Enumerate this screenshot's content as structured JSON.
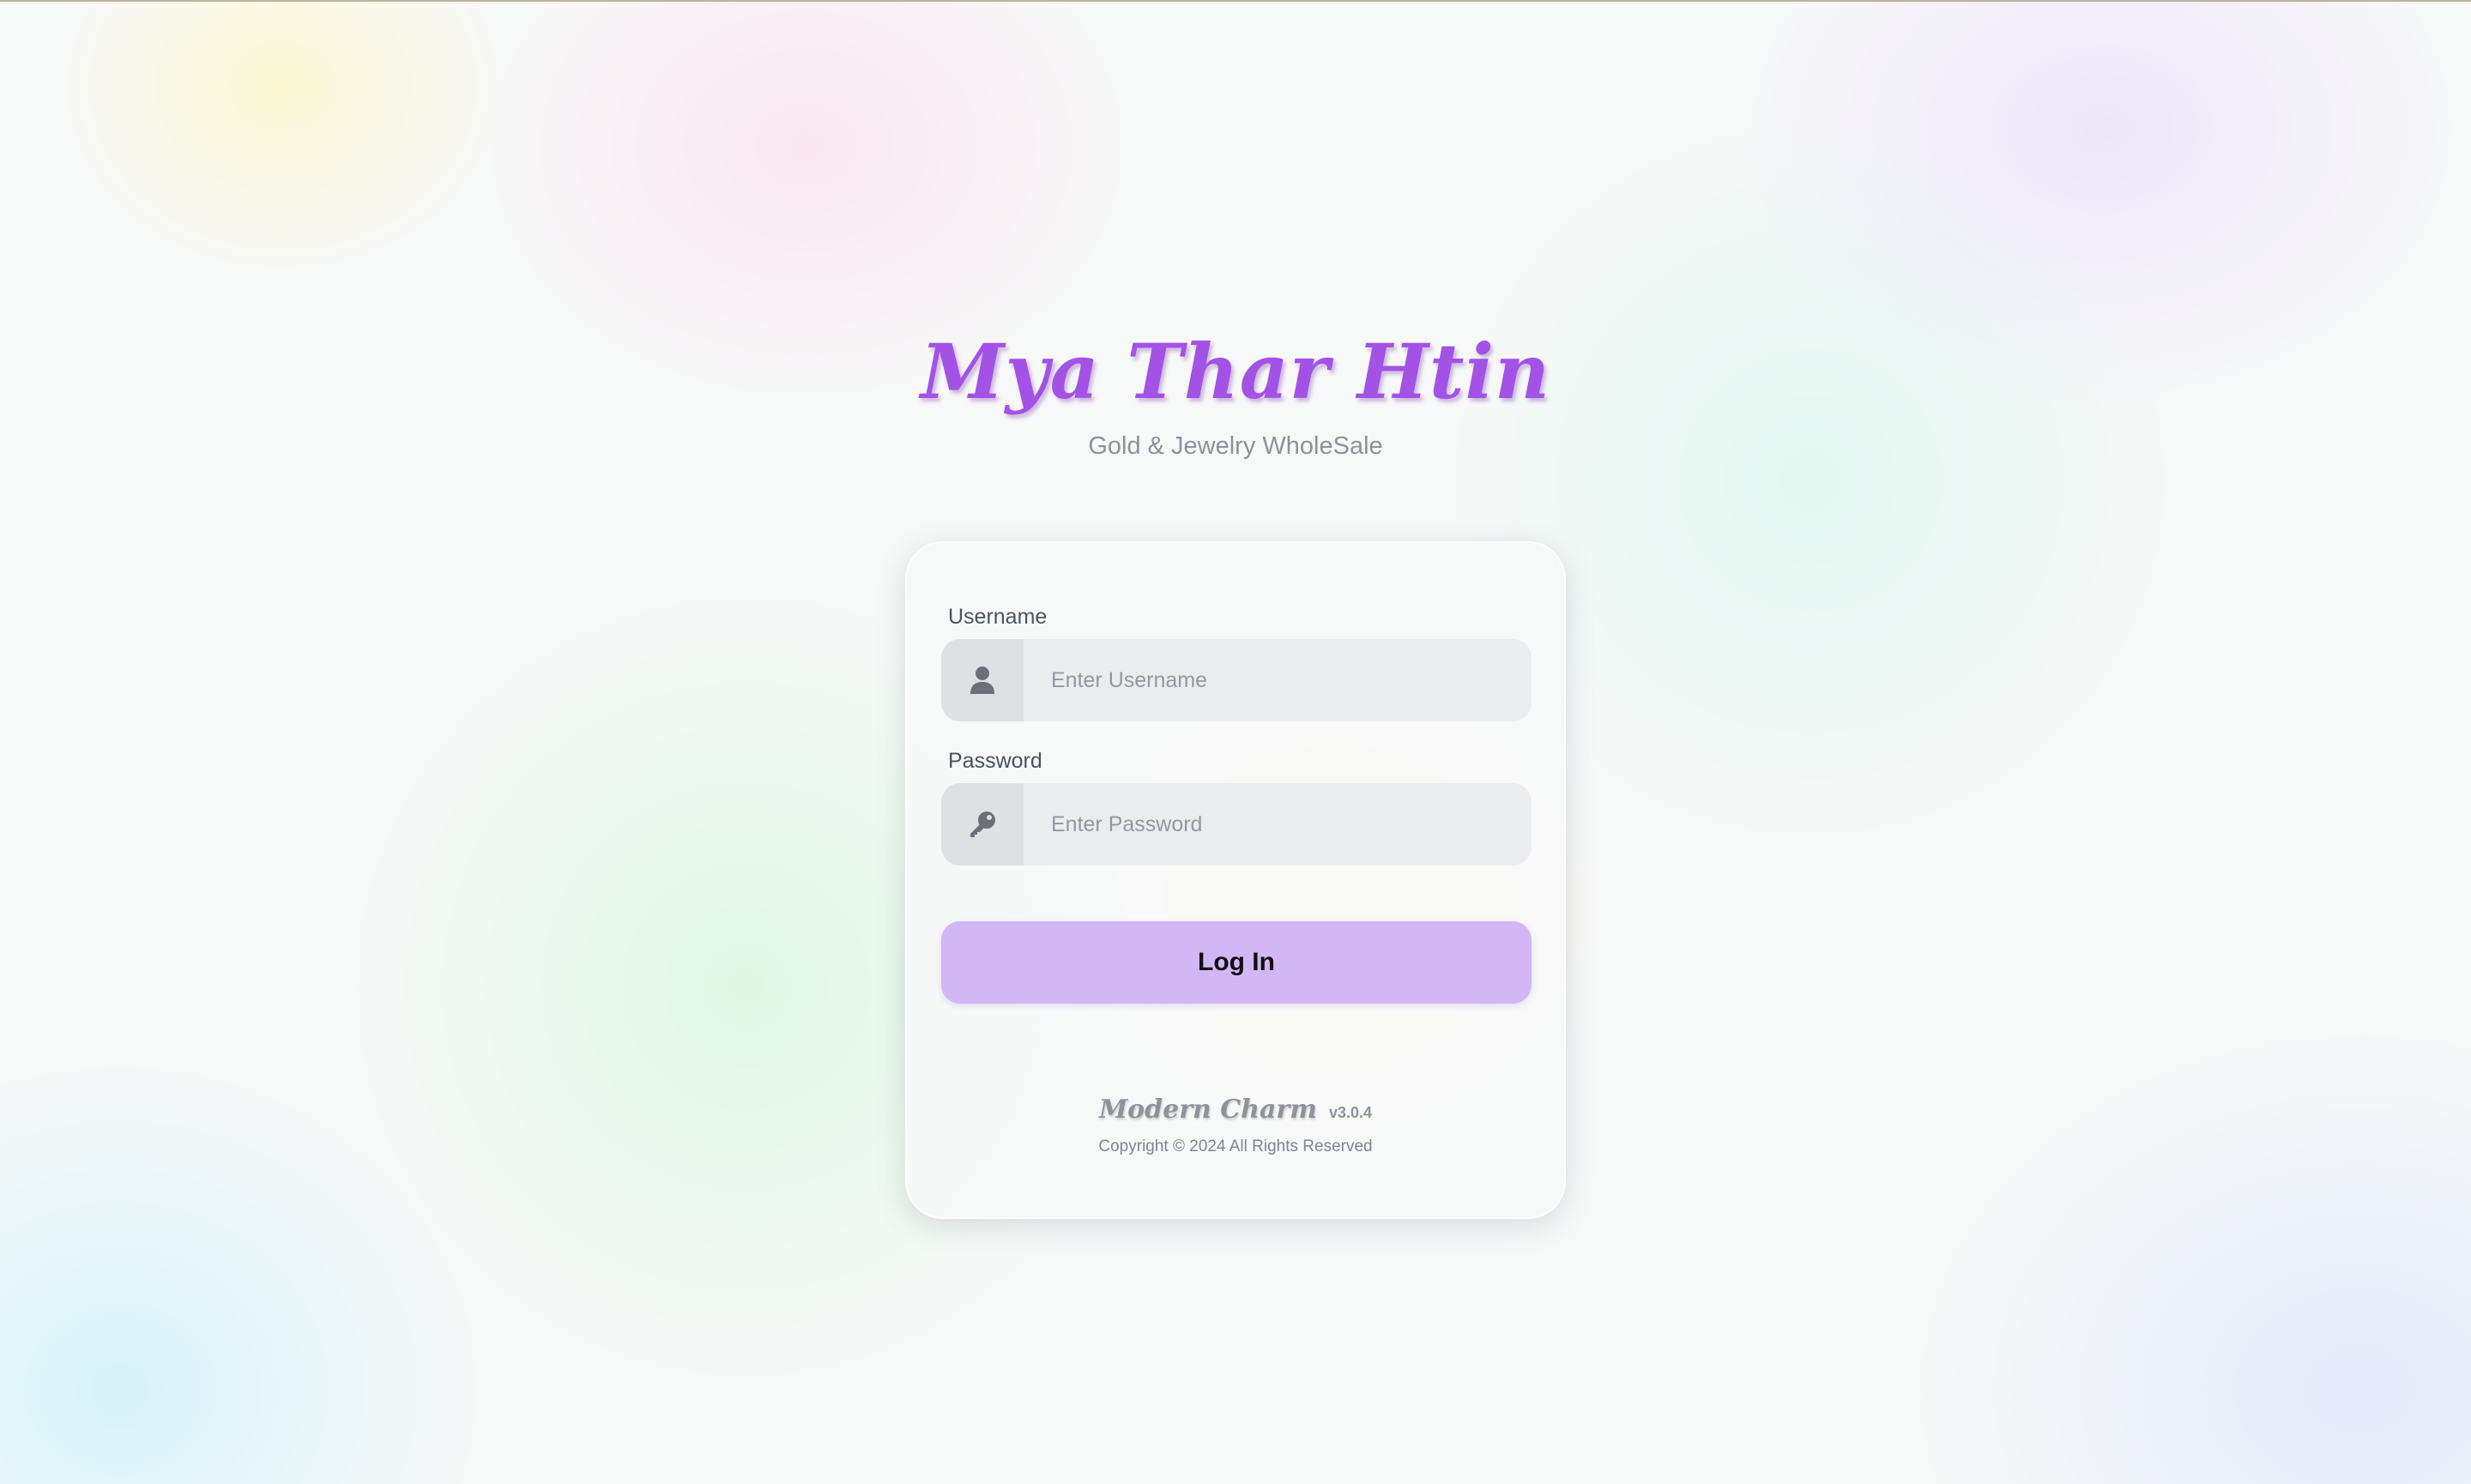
{
  "brand": {
    "title": "Mya Thar Htin",
    "subtitle": "Gold & Jewelry WholeSale"
  },
  "login_form": {
    "username": {
      "label": "Username",
      "placeholder": "Enter Username",
      "value": "",
      "icon": "user-icon"
    },
    "password": {
      "label": "Password",
      "placeholder": "Enter Password",
      "value": "",
      "icon": "key-icon"
    },
    "submit_label": "Log In"
  },
  "footer": {
    "theme_name": "Modern Charm",
    "version": "v3.0.4",
    "copyright": "Copyright © 2024 All Rights Reserved"
  },
  "colors": {
    "brand_accent": "#a352e6",
    "button_background": "#d2b6f6",
    "icon_color": "#6b6f78"
  }
}
